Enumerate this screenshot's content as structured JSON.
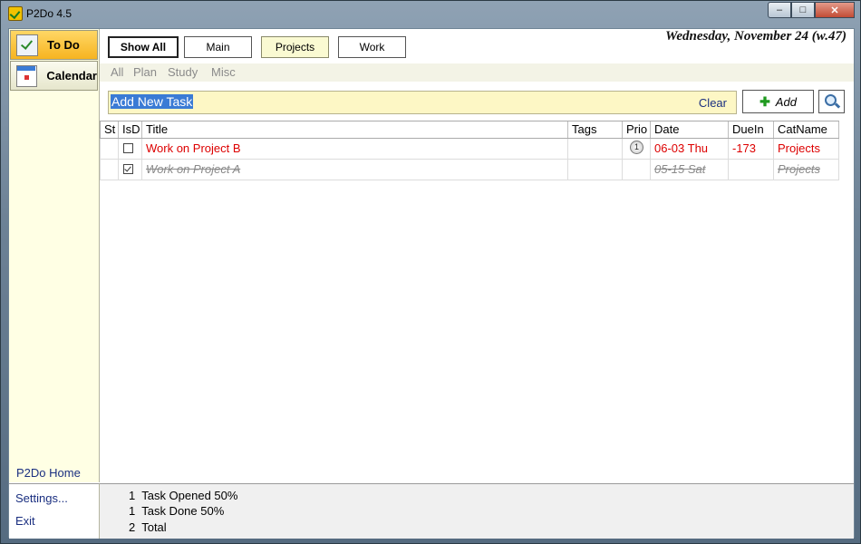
{
  "window": {
    "title": "P2Do 4.5"
  },
  "sidebar": {
    "todo_label": "To Do",
    "calendar_label": "Calendar",
    "home_link": "P2Do Home",
    "settings": "Settings...",
    "exit": "Exit"
  },
  "filters": {
    "buttons": [
      {
        "label": "Show All"
      },
      {
        "label": "Main"
      },
      {
        "label": "Projects",
        "selected": true
      },
      {
        "label": "Work"
      }
    ],
    "sub": [
      "All",
      "Plan",
      "Study",
      "Misc"
    ]
  },
  "date_display": "Wednesday, November 24 (w.47)",
  "task_entry": {
    "value": "Add New Task",
    "clear": "Clear"
  },
  "add_button": "Add",
  "grid": {
    "headers": [
      "St",
      "IsD",
      "Title",
      "Tags",
      "Prio",
      "Date",
      "DueIn",
      "CatName"
    ],
    "rows": [
      {
        "done": false,
        "title": "Work on Project B",
        "tags": "",
        "prio": "1",
        "date": "06-03 Thu",
        "duein": "-173",
        "cat": "Projects"
      },
      {
        "done": true,
        "title": "Work on Project A",
        "tags": "",
        "prio": "",
        "date": "05-15 Sat",
        "duein": "",
        "cat": "Projects"
      }
    ]
  },
  "status": {
    "lines": [
      "1  Task Opened 50%",
      "1  Task Done 50%",
      "2  Total"
    ]
  },
  "colors": {
    "accent": "#3a7bd5",
    "overdue": "#dd0000",
    "sidebar_bg": "#ffffe4"
  }
}
